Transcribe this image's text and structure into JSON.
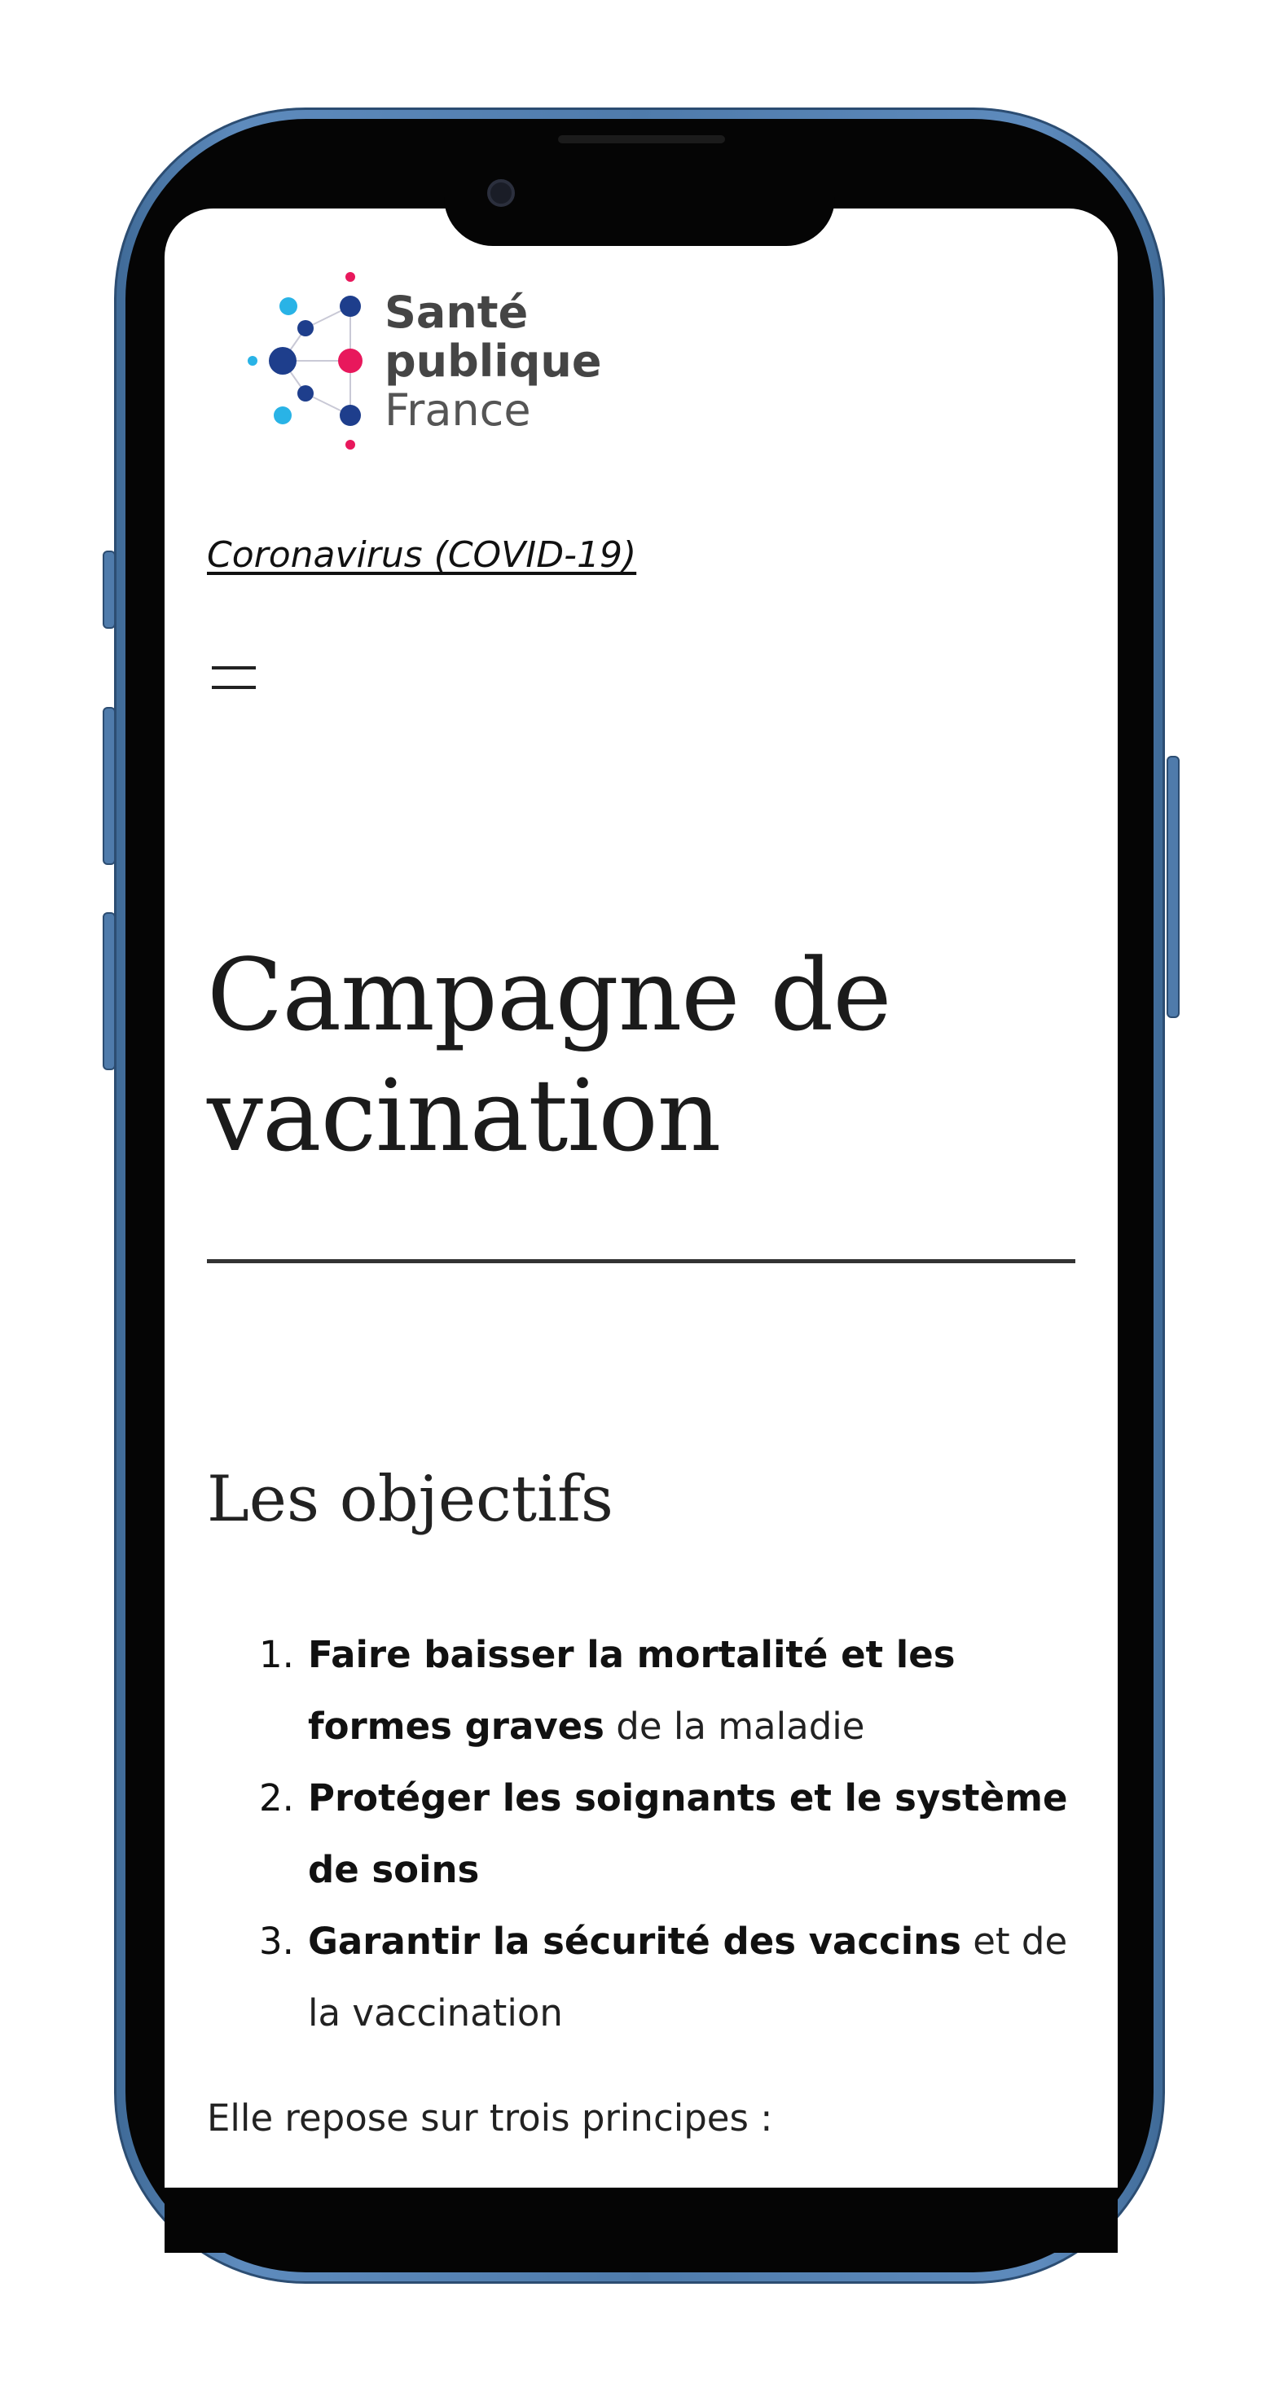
{
  "colors": {
    "frame": "#4f7bab",
    "logo_pink": "#e8185c",
    "logo_navy": "#1e3e8c",
    "logo_cyan": "#29b3e6"
  },
  "logo": {
    "line1": "Santé",
    "line2": "publique",
    "line3": "France"
  },
  "breadcrumb": "Coronavirus (COVID-19)",
  "menu_icon": "hamburger-icon",
  "page_title": "Campagne de vacination",
  "section_title": "Les objectifs",
  "objectives": [
    {
      "num": "1.",
      "strong": "Faire baisser la mortalité et les formes graves",
      "rest": " de la maladie"
    },
    {
      "num": "2.",
      "strong": "Protéger les soignants et le système de soins",
      "rest": ""
    },
    {
      "num": "3.",
      "strong": "Garantir la sécurité des vaccins",
      "rest": " et de la vaccination"
    }
  ],
  "principles_intro": "Elle repose sur trois principes :"
}
